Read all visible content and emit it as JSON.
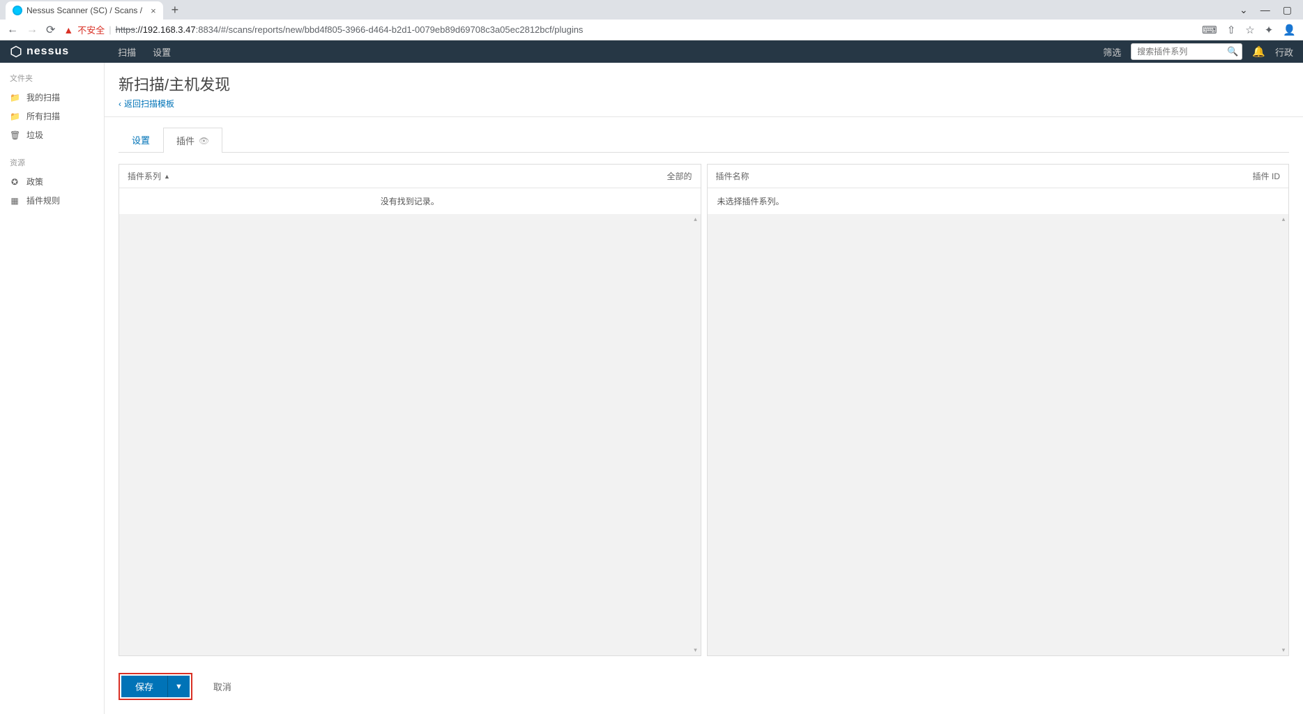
{
  "browser": {
    "tab_title": "Nessus Scanner (SC) / Scans /",
    "insecure_label": "不安全",
    "url_protocol": "https",
    "url_host": "://192.168.3.47",
    "url_path": ":8834/#/scans/reports/new/bbd4f805-3966-d464-b2d1-0079eb89d69708c3a05ec2812bcf/plugins"
  },
  "header": {
    "brand": "nessus",
    "nav": [
      "扫描",
      "设置"
    ],
    "filter_label": "筛选",
    "search_placeholder": "搜索插件系列",
    "admin_label": "行政"
  },
  "sidebar": {
    "folders_header": "文件夹",
    "folders": [
      {
        "icon": "📁",
        "label": "我的扫描"
      },
      {
        "icon": "📁",
        "label": "所有扫描"
      },
      {
        "icon": "🗑",
        "label": "垃圾"
      }
    ],
    "resources_header": "资源",
    "resources": [
      {
        "icon": "✪",
        "label": "政策"
      },
      {
        "icon": "▦",
        "label": "插件规则"
      }
    ]
  },
  "page": {
    "title": "新扫描/主机发现",
    "back_label": "返回扫描模板",
    "tabs": [
      {
        "label": "设置",
        "active": true
      },
      {
        "label": "插件",
        "selected": true
      }
    ]
  },
  "panels": {
    "left": {
      "col1": "插件系列",
      "col2": "全部的",
      "empty": "没有找到记录。"
    },
    "right": {
      "col1": "插件名称",
      "col2": "插件 ID",
      "empty": "未选择插件系列。"
    }
  },
  "footer": {
    "save": "保存",
    "cancel": "取消"
  }
}
